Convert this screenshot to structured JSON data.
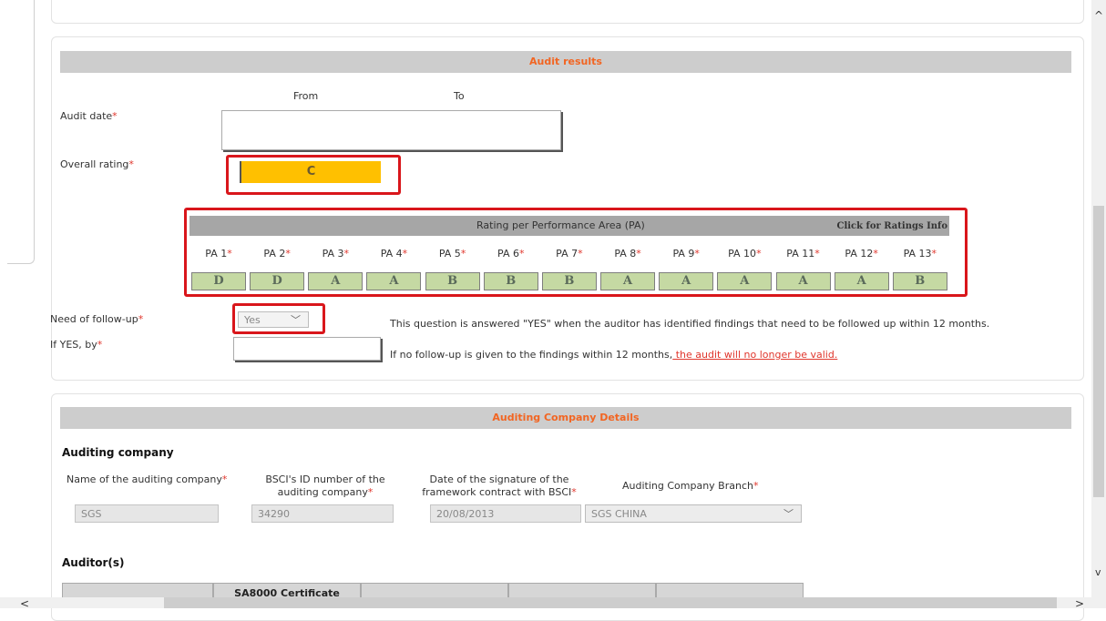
{
  "audit_results": {
    "title": "Audit results",
    "from_label": "From",
    "to_label": "To",
    "audit_date_label": "Audit date",
    "overall_rating_label": "Overall rating",
    "overall_rating_value": "C",
    "pa_table_title": "Rating per Performance Area (PA)",
    "ratings_info_link": "Click for Ratings Info",
    "pa_labels": [
      "PA 1",
      "PA 2",
      "PA 3",
      "PA 4",
      "PA 5",
      "PA 6",
      "PA 7",
      "PA 8",
      "PA 9",
      "PA 10",
      "PA 11",
      "PA 12",
      "PA 13"
    ],
    "pa_values": [
      "D",
      "D",
      "A",
      "A",
      "B",
      "B",
      "B",
      "A",
      "A",
      "A",
      "A",
      "A",
      "B"
    ],
    "followup_label": "Need of follow-up",
    "followup_value": "Yes",
    "followup_note": "This question is answered \"YES\" when the auditor has identified findings that need to be followed up within 12 months.",
    "if_yes_label": "If YES, by",
    "validity_note": "If no follow-up is given to the findings within 12 months,",
    "validity_warning": " the audit will no longer be valid."
  },
  "auditing_company": {
    "title": "Auditing Company Details",
    "subheading": "Auditing company",
    "name_label": "Name of the auditing company",
    "id_label_1": "BSCI's ID number of the",
    "id_label_2": "auditing company",
    "date_label_1": "Date of the signature of the",
    "date_label_2": "framework contract with BSCI",
    "branch_label": "Auditing Company Branch",
    "name_value": "SGS",
    "id_value": "34290",
    "date_value": "20/08/2013",
    "branch_value": "SGS CHINA",
    "auditors_heading": "Auditor(s)",
    "table_header_sa8000": "SA8000 Certificate"
  },
  "required_marker": "*",
  "scroll": {
    "up": "^",
    "down": "v",
    "left": "<",
    "right": ">"
  }
}
